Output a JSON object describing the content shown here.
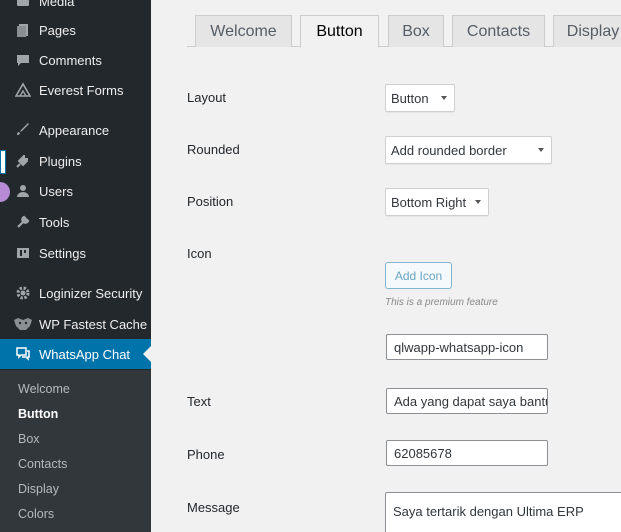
{
  "sidebar": {
    "items": [
      {
        "label": "Media",
        "icon": "media-icon"
      },
      {
        "label": "Pages",
        "icon": "pages-icon"
      },
      {
        "label": "Comments",
        "icon": "comments-icon"
      },
      {
        "label": "Everest Forms",
        "icon": "everest-forms-icon"
      },
      {
        "label": "Appearance",
        "icon": "appearance-icon"
      },
      {
        "label": "Plugins",
        "icon": "plugins-icon"
      },
      {
        "label": "Users",
        "icon": "users-icon"
      },
      {
        "label": "Tools",
        "icon": "tools-icon"
      },
      {
        "label": "Settings",
        "icon": "settings-icon"
      },
      {
        "label": "Loginizer Security",
        "icon": "gear-icon"
      },
      {
        "label": "WP Fastest Cache",
        "icon": "cheetah-icon"
      },
      {
        "label": "WhatsApp Chat",
        "icon": "chat-icon"
      }
    ],
    "submenu": [
      {
        "label": "Welcome"
      },
      {
        "label": "Button"
      },
      {
        "label": "Box"
      },
      {
        "label": "Contacts"
      },
      {
        "label": "Display"
      },
      {
        "label": "Colors"
      }
    ]
  },
  "tabs": [
    {
      "label": "Welcome"
    },
    {
      "label": "Button"
    },
    {
      "label": "Box"
    },
    {
      "label": "Contacts"
    },
    {
      "label": "Display"
    }
  ],
  "form": {
    "layout": {
      "label": "Layout",
      "value": "Button"
    },
    "rounded": {
      "label": "Rounded",
      "value": "Add rounded border"
    },
    "position": {
      "label": "Position",
      "value": "Bottom Right"
    },
    "icon": {
      "label": "Icon",
      "button": "Add Icon",
      "note": "This is a premium feature",
      "value": "qlwapp-whatsapp-icon"
    },
    "text": {
      "label": "Text",
      "value": "Ada yang dapat saya bantu"
    },
    "phone": {
      "label": "Phone",
      "value": "62085678"
    },
    "message": {
      "label": "Message",
      "value": "Saya tertarik dengan Ultima ERP"
    }
  },
  "colors": {
    "sidebar_bg": "#23282d",
    "submenu_bg": "#32373c",
    "accent": "#0073aa",
    "content_bg": "#f1f1f1"
  }
}
